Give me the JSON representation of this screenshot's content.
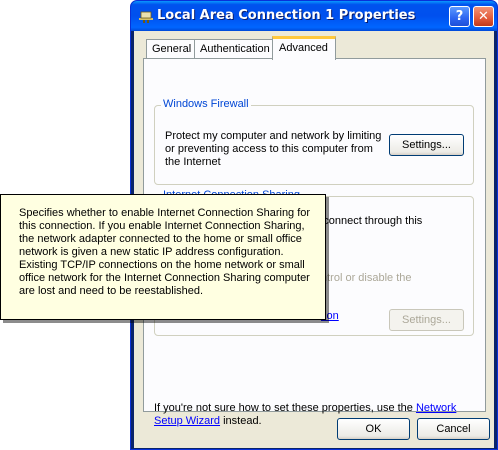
{
  "window": {
    "title": "Local Area Connection 1 Properties",
    "help_label": "?",
    "close_label": "✕"
  },
  "tabs": [
    {
      "label": "General"
    },
    {
      "label": "Authentication"
    },
    {
      "label": "Advanced",
      "selected": true
    }
  ],
  "firewall": {
    "group_label": "Windows Firewall",
    "description": "Protect my computer and network by limiting or preventing access to this computer from the Internet",
    "settings_button": "Settings..."
  },
  "ics": {
    "group_label": "Internet Connection Sharing",
    "allow_label_line1": "Allow other network users to connect through this",
    "allow_label_line2": "",
    "control_text": "ntrol or disable the",
    "link_text": "tion",
    "settings_button": "Settings...",
    "allow_checked": false
  },
  "footer": {
    "text_before": "If you're not sure how to set these properties, use the ",
    "link": "Network Setup Wizard",
    "text_after": " instead."
  },
  "buttons": {
    "ok": "OK",
    "cancel": "Cancel"
  },
  "tooltip": {
    "text": "Specifies whether to enable Internet Connection Sharing for this connection. If you enable Internet Connection Sharing, the network adapter connected to the home or small office network is given a new static IP address configuration. Existing TCP/IP connections on the home network or small office network for the Internet Connection Sharing computer are lost and need to be reestablished."
  },
  "colors": {
    "title_bar": "#0054e3",
    "group_label": "#0046d5",
    "tooltip_bg": "#ffffe1",
    "link": "#0000ff"
  }
}
